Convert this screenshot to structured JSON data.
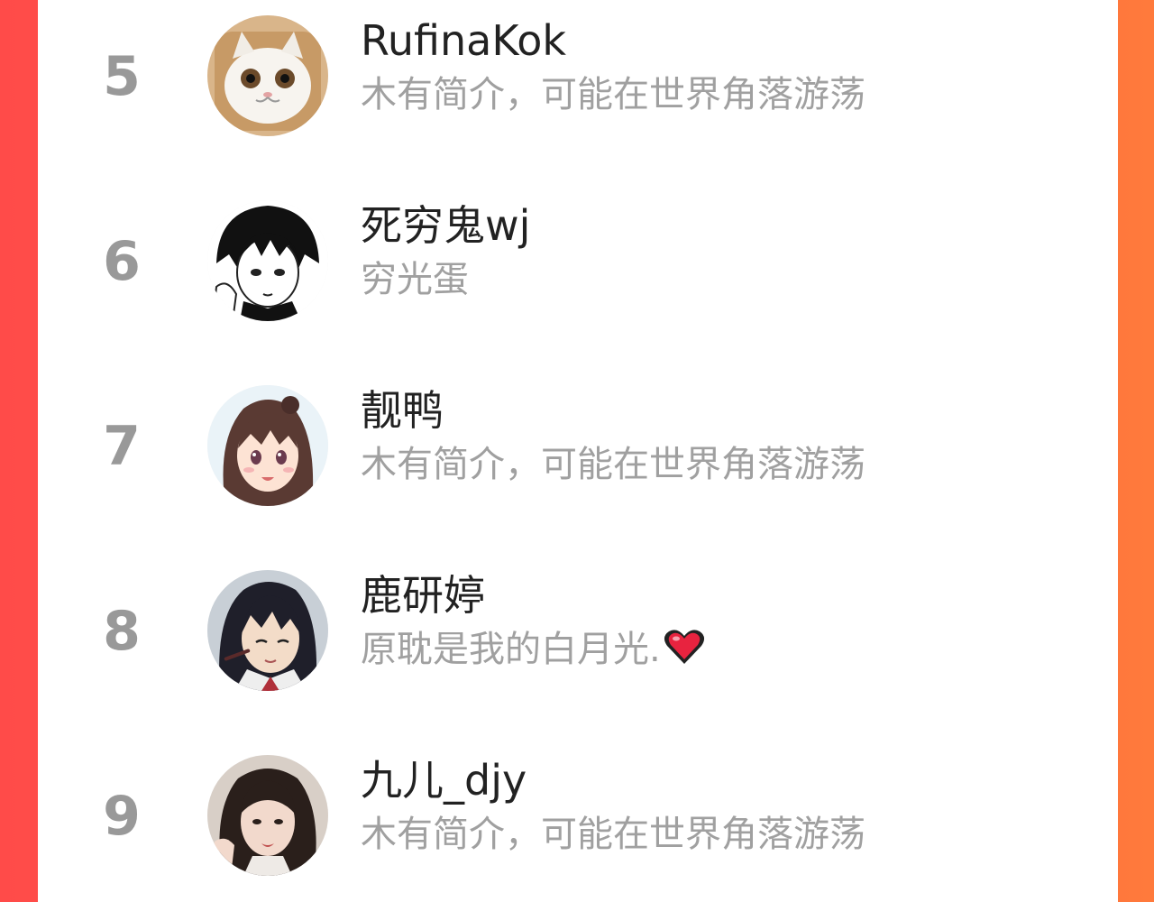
{
  "ranking": {
    "rows": [
      {
        "rank": "5",
        "username": "RufinaKok",
        "bio": "木有简介，可能在世界角落游荡",
        "avatar_icon": "cat-avatar"
      },
      {
        "rank": "6",
        "username": "死穷鬼wj",
        "bio": "穷光蛋",
        "avatar_icon": "manga-boy-avatar"
      },
      {
        "rank": "7",
        "username": "靓鸭",
        "bio": "木有简介，可能在世界角落游荡",
        "avatar_icon": "anime-girl-avatar"
      },
      {
        "rank": "8",
        "username": "鹿研婷",
        "bio": "原耽是我的白月光.",
        "avatar_icon": "anime-man-avatar",
        "bio_icon": "heart-icon"
      },
      {
        "rank": "9",
        "username": "九儿_djy",
        "bio": "木有简介，可能在世界角落游荡",
        "avatar_icon": "photo-girl-avatar"
      }
    ]
  },
  "colors": {
    "background_left": "#ff4b49",
    "background_right": "#ff7a3c",
    "card": "#ffffff",
    "rank_text": "#999999",
    "username_text": "#222222",
    "bio_text": "#a0a0a0",
    "heart": "#e8233f"
  }
}
